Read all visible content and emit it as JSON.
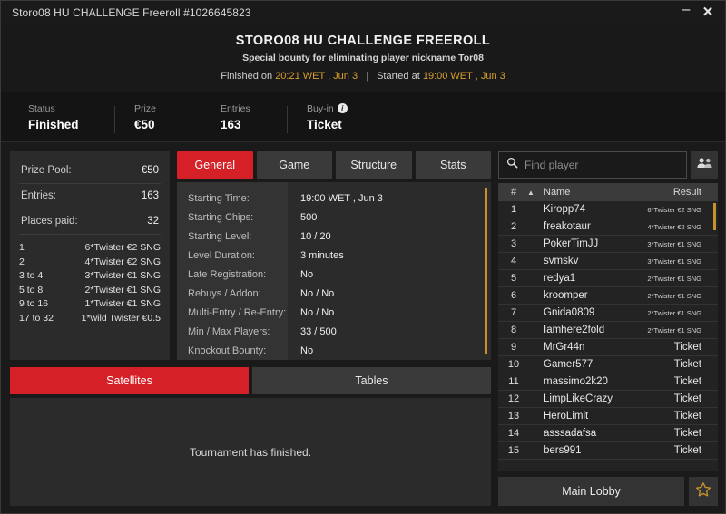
{
  "titlebar": {
    "title": "Storo08 HU CHALLENGE Freeroll #1026645823",
    "minimize_label": "–",
    "close_label": "✕"
  },
  "header": {
    "title": "STORO08 HU CHALLENGE FREEROLL",
    "subtitle": "Special bounty for eliminating player nickname Tor08",
    "finished_prefix": "Finished on",
    "finished_time": "20:21 WET , Jun 3",
    "separator": "|",
    "started_prefix": "Started at",
    "started_time": "19:00 WET , Jun 3"
  },
  "status_strip": [
    {
      "label": "Status",
      "value": "Finished",
      "has_info_icon": false
    },
    {
      "label": "Prize",
      "value": "€50",
      "has_info_icon": false
    },
    {
      "label": "Entries",
      "value": "163",
      "has_info_icon": false
    },
    {
      "label": "Buy-in",
      "value": "Ticket",
      "has_info_icon": true
    }
  ],
  "prize_panel": {
    "rows": [
      {
        "label": "Prize Pool:",
        "value": "€50"
      },
      {
        "label": "Entries:",
        "value": "163"
      },
      {
        "label": "Places paid:",
        "value": "32"
      }
    ],
    "payouts": [
      {
        "place": "1",
        "prize": "6*Twister €2 SNG"
      },
      {
        "place": "2",
        "prize": "4*Twister €2 SNG"
      },
      {
        "place": "3  to  4",
        "prize": "3*Twister €1 SNG"
      },
      {
        "place": "5  to  8",
        "prize": "2*Twister €1 SNG"
      },
      {
        "place": "9  to  16",
        "prize": "1*Twister €1 SNG"
      },
      {
        "place": "17  to  32",
        "prize": "1*wild Twister €0.5"
      }
    ]
  },
  "detail_tabs": [
    {
      "label": "General",
      "active": true
    },
    {
      "label": "Game",
      "active": false
    },
    {
      "label": "Structure",
      "active": false
    },
    {
      "label": "Stats",
      "active": false
    }
  ],
  "general_info": [
    {
      "label": "Starting Time:",
      "value": "19:00 WET , Jun 3"
    },
    {
      "label": "Starting Chips:",
      "value": "500"
    },
    {
      "label": "Starting Level:",
      "value": "10 / 20"
    },
    {
      "label": "Level Duration:",
      "value": "3 minutes"
    },
    {
      "label": "Late Registration:",
      "value": "No"
    },
    {
      "label": "Rebuys / Addon:",
      "value": "No / No"
    },
    {
      "label": "Multi-Entry / Re-Entry:",
      "value": "No / No"
    },
    {
      "label": "Min / Max Players:",
      "value": "33 / 500"
    },
    {
      "label": "Knockout Bounty:",
      "value": "No"
    }
  ],
  "lower_tabs": [
    {
      "label": "Satellites",
      "active": true
    },
    {
      "label": "Tables",
      "active": false
    }
  ],
  "lower_message": "Tournament has finished.",
  "search": {
    "placeholder": "Find player",
    "value": "",
    "icon": "search-icon",
    "people_icon": "people-icon"
  },
  "player_table": {
    "headers": {
      "num": "#",
      "sort": "▲",
      "name": "Name",
      "result": "Result"
    },
    "rows": [
      {
        "num": "1",
        "name": "Kiropp74",
        "result": "6*Twister €2 SNG",
        "small": true
      },
      {
        "num": "2",
        "name": "freakotaur",
        "result": "4*Twister €2 SNG",
        "small": true
      },
      {
        "num": "3",
        "name": "PokerTimJJ",
        "result": "3*Twister €1 SNG",
        "small": true
      },
      {
        "num": "4",
        "name": "svmskv",
        "result": "3*Twister €1 SNG",
        "small": true
      },
      {
        "num": "5",
        "name": "redya1",
        "result": "2*Twister €1 SNG",
        "small": true
      },
      {
        "num": "6",
        "name": "kroomper",
        "result": "2*Twister €1 SNG",
        "small": true
      },
      {
        "num": "7",
        "name": "Gnida0809",
        "result": "2*Twister €1 SNG",
        "small": true
      },
      {
        "num": "8",
        "name": "Iamhere2fold",
        "result": "2*Twister €1 SNG",
        "small": true
      },
      {
        "num": "9",
        "name": "MrGr44n",
        "result": "Ticket",
        "small": false
      },
      {
        "num": "10",
        "name": "Gamer577",
        "result": "Ticket",
        "small": false
      },
      {
        "num": "11",
        "name": "massimo2k20",
        "result": "Ticket",
        "small": false
      },
      {
        "num": "12",
        "name": "LimpLikeCrazy",
        "result": "Ticket",
        "small": false
      },
      {
        "num": "13",
        "name": "HeroLimit",
        "result": "Ticket",
        "small": false
      },
      {
        "num": "14",
        "name": "asssadafsa",
        "result": "Ticket",
        "small": false
      },
      {
        "num": "15",
        "name": "bers991",
        "result": "Ticket",
        "small": false
      }
    ]
  },
  "bottom": {
    "main_lobby_label": "Main Lobby",
    "star_icon": "star-icon"
  },
  "colors": {
    "accent_red": "#d62027",
    "gold": "#c8912c",
    "panel": "#2b2b2b",
    "window_bg": "#1a1a1a"
  }
}
